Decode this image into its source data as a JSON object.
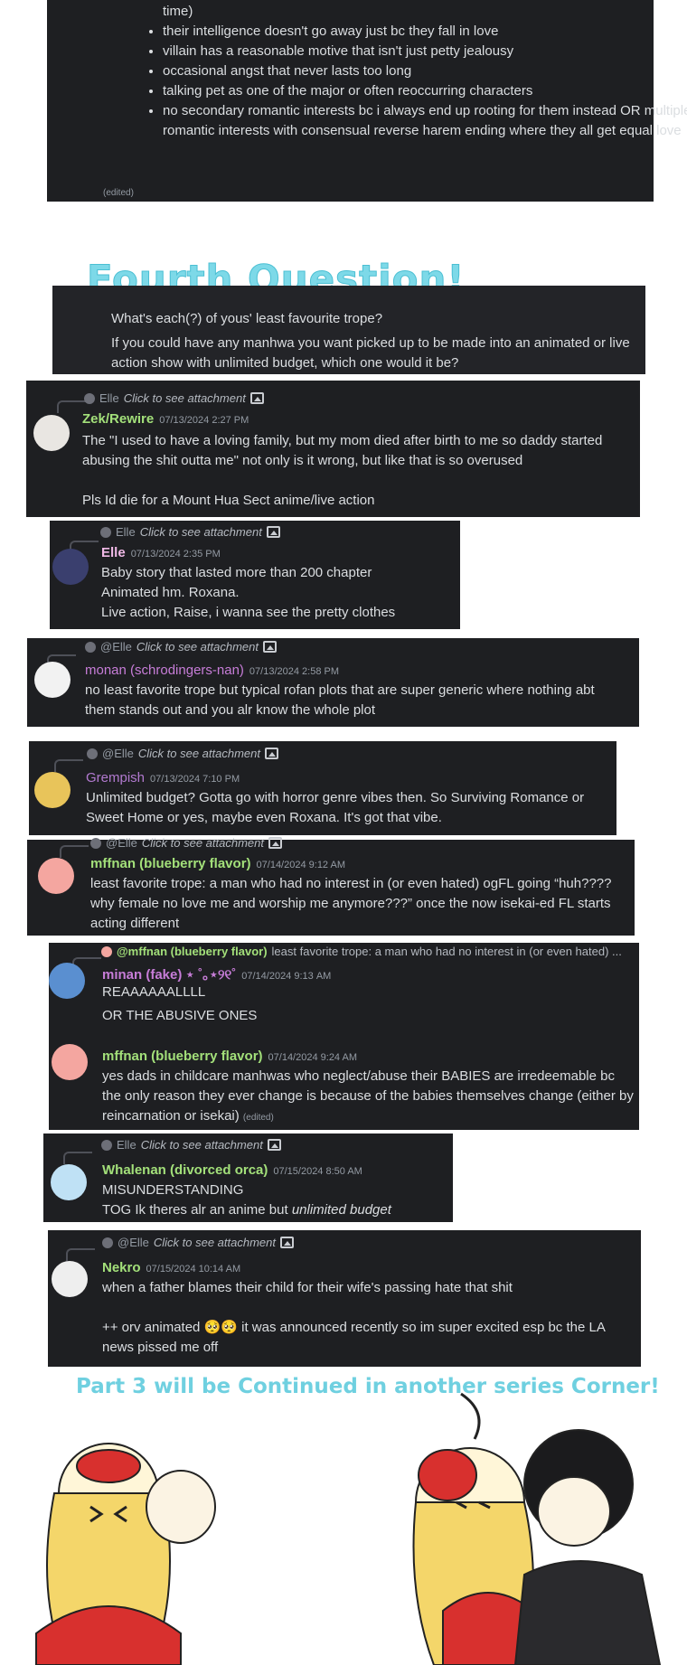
{
  "intro_block": {
    "bullets": [
      "time)",
      "their intelligence doesn't go away just bc they fall in love",
      "villain has a reasonable motive that isn't just petty jealousy",
      "occasional angst that never lasts too long",
      "talking pet as one of the major or often reoccurring characters",
      "no secondary romantic interests bc i always end up rooting for them instead OR multiple romantic interests with consensual reverse harem ending where they all get equal love"
    ],
    "edited": "(edited)"
  },
  "question": {
    "title": "Fourth Question!",
    "line1": "What's each(?) of yous' least favourite trope?",
    "line2": "If you could have any manhwa you want picked up to be made into an animated or live action show with unlimited budget, which one would it be?"
  },
  "messages": {
    "m1": {
      "reply_user": "Elle",
      "reply_text": "Click to see attachment",
      "name": "Zek/Rewire",
      "ts": "07/13/2024 2:27 PM",
      "name_color": "#a3e07a",
      "l1": "The \"I used to have a loving family, but my mom died after birth to me so daddy started abusing the shit outta me\" not only is it wrong, but like that is so overused",
      "l2": "Pls Id die for a Mount Hua Sect anime/live action"
    },
    "m2": {
      "reply_user": "Elle",
      "reply_text": "Click to see attachment",
      "name": "Elle",
      "ts": "07/13/2024 2:35 PM",
      "name_color": "#f0b9e6",
      "l1": "Baby story that lasted more than 200 chapter",
      "l2": "Animated hm. Roxana.",
      "l3": "Live action, Raise, i wanna see the  pretty clothes"
    },
    "m3": {
      "reply_user": "@Elle",
      "reply_text": "Click to see attachment",
      "name": "monan (schrodingers-nan)",
      "ts": "07/13/2024 2:58 PM",
      "name_color": "#c77dd8",
      "l1": "no least favorite trope but typical rofan plots that are super generic where nothing abt them stands out and you alr know the whole plot"
    },
    "m4": {
      "reply_user": "@Elle",
      "reply_text": "Click to see attachment",
      "name": "Grempish",
      "ts": "07/13/2024 7:10 PM",
      "name_color": "#b27ad0",
      "l1": "Unlimited budget? Gotta go with horror genre vibes then. So Surviving Romance or Sweet Home or yes, maybe even Roxana. It's got that vibe."
    },
    "m5": {
      "reply_user": "@Elle",
      "reply_text": "Click to see attachment",
      "name": "mffnan (blueberry flavor)",
      "ts": "07/14/2024 9:12 AM",
      "name_color": "#a3e07a",
      "l1": "least favorite trope: a man who had no interest in (or even hated) ogFL going “huh???? why female no love me and worship me anymore???” once the now isekai-ed FL starts acting different"
    },
    "m6": {
      "reply_user": "@mffnan (blueberry flavor)",
      "reply_text": "least favorite trope: a man who had no interest in (or even hated) ...",
      "name": "minan (fake) ⋆ ˚｡⋆୨୧˚",
      "ts": "07/14/2024 9:13 AM",
      "name_color": "#c77dd8",
      "l1": "REAAAAAALLLL",
      "l2": "OR THE ABUSIVE ONES"
    },
    "m7": {
      "name": "mffnan (blueberry flavor)",
      "ts": "07/14/2024 9:24 AM",
      "name_color": "#a3e07a",
      "l1": "yes dads in childcare manhwas who neglect/abuse their BABIES are irredeemable bc the only reason they ever change is because of the babies themselves change (either by reincarnation or isekai)",
      "edited": "(edited)"
    },
    "m8": {
      "reply_user": "Elle",
      "reply_text": "Click to see attachment",
      "name": "Whalenan (divorced orca)",
      "ts": "07/15/2024 8:50 AM",
      "name_color": "#a3e07a",
      "l1": "MISUNDERSTANDING",
      "l2a": "TOG Ik theres alr an anime but ",
      "l2b": "unlimited budget"
    },
    "m9": {
      "reply_user": "@Elle",
      "reply_text": "Click to see attachment",
      "name": "Nekro",
      "ts": "07/15/2024 10:14 AM",
      "name_color": "#a3e07a",
      "l1": "when a father blames their child for their wife's passing hate that shit",
      "l2a": "++ orv animated ",
      "emoji": "🥺🥺",
      "l2b": " it was announced recently so im super excited esp bc the LA news pissed me off"
    }
  },
  "footer": {
    "continued": "Part 3 will be Continued in another series Corner!"
  },
  "colors": {
    "panel_bg": "#1e1f22",
    "accent_cyan": "#7dd9e8",
    "username_green": "#a3e07a",
    "username_purple": "#c77dd8"
  },
  "icons": [
    "image-attachment-icon",
    "reply-connector",
    "avatar"
  ]
}
